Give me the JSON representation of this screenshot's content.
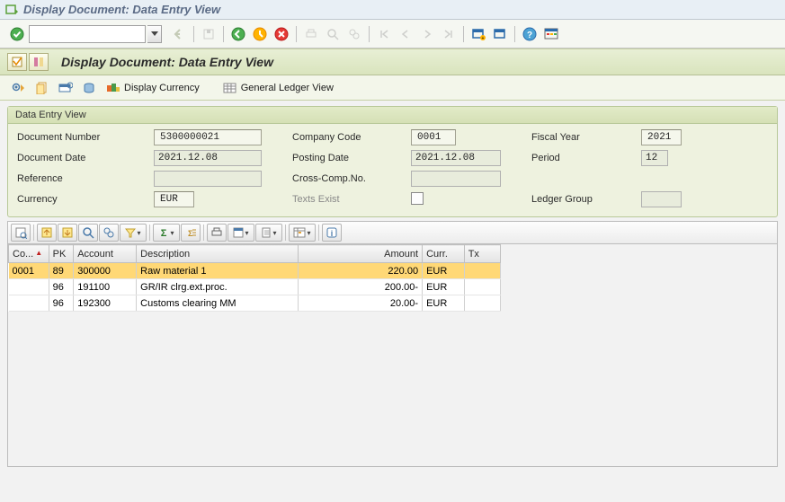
{
  "window_title": "Display Document: Data Entry View",
  "app_title": "Display Document: Data Entry View",
  "app_toolbar": {
    "display_currency": "Display Currency",
    "gl_view": "General Ledger View"
  },
  "panel": {
    "title": "Data Entry View",
    "labels": {
      "doc_number": "Document Number",
      "company_code": "Company Code",
      "fiscal_year": "Fiscal Year",
      "doc_date": "Document Date",
      "posting_date": "Posting Date",
      "period": "Period",
      "reference": "Reference",
      "cross_comp": "Cross-Comp.No.",
      "currency": "Currency",
      "texts_exist": "Texts Exist",
      "ledger_group": "Ledger Group"
    },
    "values": {
      "doc_number": "5300000021",
      "company_code": "0001",
      "fiscal_year": "2021",
      "doc_date": "2021.12.08",
      "posting_date": "2021.12.08",
      "period": "12",
      "reference": "",
      "cross_comp": "",
      "currency": "EUR",
      "ledger_group": ""
    }
  },
  "grid": {
    "columns": {
      "co": "Co...",
      "pk": "PK",
      "account": "Account",
      "description": "Description",
      "amount": "Amount",
      "curr": "Curr.",
      "tx": "Tx"
    },
    "rows": [
      {
        "co": "0001",
        "pk": "89",
        "account": "300000",
        "description": "Raw material 1",
        "amount": "220.00",
        "curr": "EUR",
        "tx": ""
      },
      {
        "co": "",
        "pk": "96",
        "account": "191100",
        "description": "GR/IR clrg.ext.proc.",
        "amount": "200.00-",
        "curr": "EUR",
        "tx": ""
      },
      {
        "co": "",
        "pk": "96",
        "account": "192300",
        "description": "Customs clearing MM",
        "amount": "20.00-",
        "curr": "EUR",
        "tx": ""
      }
    ]
  }
}
